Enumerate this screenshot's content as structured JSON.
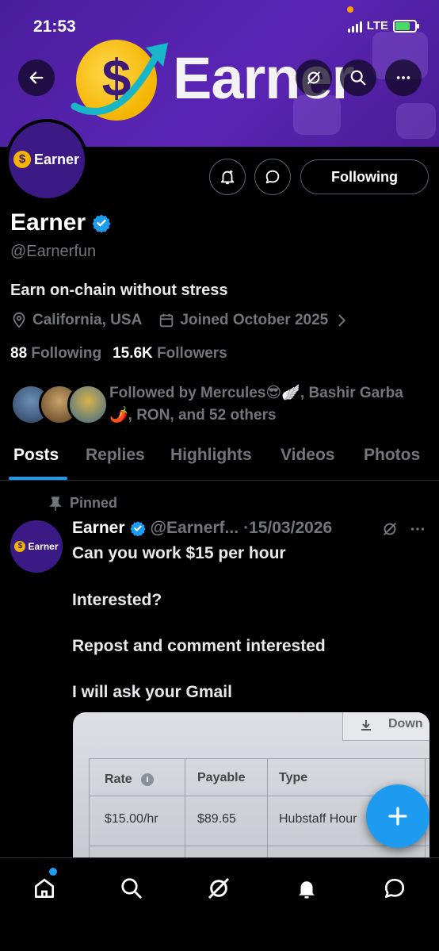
{
  "status_bar": {
    "time": "21:53",
    "network": "LTE"
  },
  "banner": {
    "brand_word": "Earner",
    "coin_symbol": "$"
  },
  "profile": {
    "avatar_word": "Earner",
    "avatar_symbol": "$",
    "name": "Earner",
    "handle": "@Earnerfun",
    "bio": "Earn on-chain without stress",
    "location": "California, USA",
    "joined": "Joined October 2025",
    "following_count": "88",
    "following_label": "Following",
    "followers_count": "15.6K",
    "followers_label": "Followers",
    "follow_button": "Following",
    "followed_by": "Followed by Mercules😎🪽, Bashir Garba🌶️, RON, and 52 others"
  },
  "tabs": [
    "Posts",
    "Replies",
    "Highlights",
    "Videos",
    "Photos"
  ],
  "post": {
    "pinned_label": "Pinned",
    "avatar_word": "Earner",
    "author": "Earner",
    "handle": "@Earnerf...",
    "date": "·15/03/2026",
    "lines": [
      "Can you work $15 per hour",
      "Interested?",
      "Repost and comment interested",
      "I will ask your Gmail"
    ],
    "image": {
      "download": "Down",
      "headers": [
        "Rate",
        "Payable",
        "Type"
      ],
      "row": [
        "$15.00/hr",
        "$89.65",
        "Hubstaff Hour"
      ]
    }
  },
  "colors": {
    "accent": "#1d9bf0",
    "banner": "#5a25b5",
    "muted": "#71767b"
  }
}
